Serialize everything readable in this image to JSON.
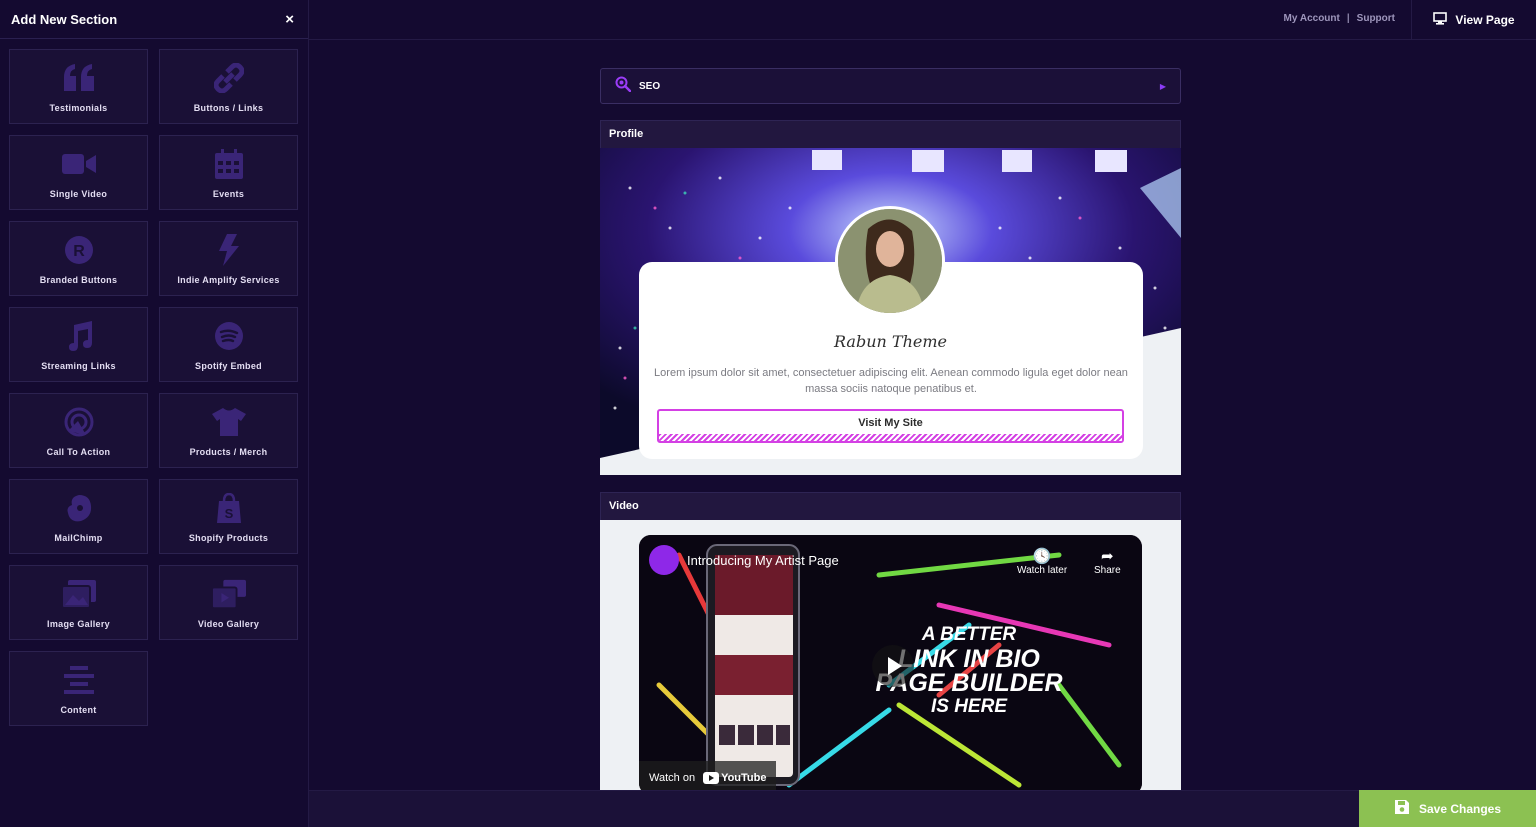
{
  "sidebar": {
    "title": "Add New Section",
    "close_icon": "×",
    "tiles": [
      {
        "label": "Testimonials",
        "icon": "quote-icon"
      },
      {
        "label": "Buttons / Links",
        "icon": "link-icon"
      },
      {
        "label": "Single Video",
        "icon": "video-camera-icon"
      },
      {
        "label": "Events",
        "icon": "calendar-icon"
      },
      {
        "label": "Branded Buttons",
        "icon": "registered-icon"
      },
      {
        "label": "Indie Amplify Services",
        "icon": "lightning-icon"
      },
      {
        "label": "Streaming Links",
        "icon": "music-note-icon"
      },
      {
        "label": "Spotify Embed",
        "icon": "spotify-icon"
      },
      {
        "label": "Call To Action",
        "icon": "target-pointer-icon"
      },
      {
        "label": "Products / Merch",
        "icon": "tshirt-icon"
      },
      {
        "label": "MailChimp",
        "icon": "mailchimp-icon"
      },
      {
        "label": "Shopify Products",
        "icon": "shopify-bag-icon"
      },
      {
        "label": "Image Gallery",
        "icon": "images-icon"
      },
      {
        "label": "Video Gallery",
        "icon": "video-gallery-icon"
      },
      {
        "label": "Content",
        "icon": "align-center-icon"
      }
    ]
  },
  "topbar": {
    "my_account": "My Account",
    "separator": "|",
    "support": "Support",
    "view_page": "View Page"
  },
  "seo": {
    "label": "SEO"
  },
  "profile": {
    "section_title": "Profile",
    "name": "Rabun Theme",
    "description": "Lorem ipsum dolor sit amet, consectetuer adipiscing elit. Aenean commodo ligula eget dolor nean massa sociis natoque penatibus et.",
    "button_label": "Visit My Site"
  },
  "video": {
    "section_title": "Video",
    "title": "Introducing My Artist Page",
    "watch_later": "Watch later",
    "share": "Share",
    "headline_lines": [
      "A BETTER",
      "LINK IN BIO",
      "PAGE BUILDER",
      "IS HERE"
    ],
    "watch_on": "Watch on",
    "youtube": "YouTube"
  },
  "footer": {
    "save_label": "Save Changes"
  },
  "colors": {
    "bg": "#140a30",
    "accent": "#8b3cf7",
    "button_border": "#d440e4",
    "save": "#8cc152"
  }
}
